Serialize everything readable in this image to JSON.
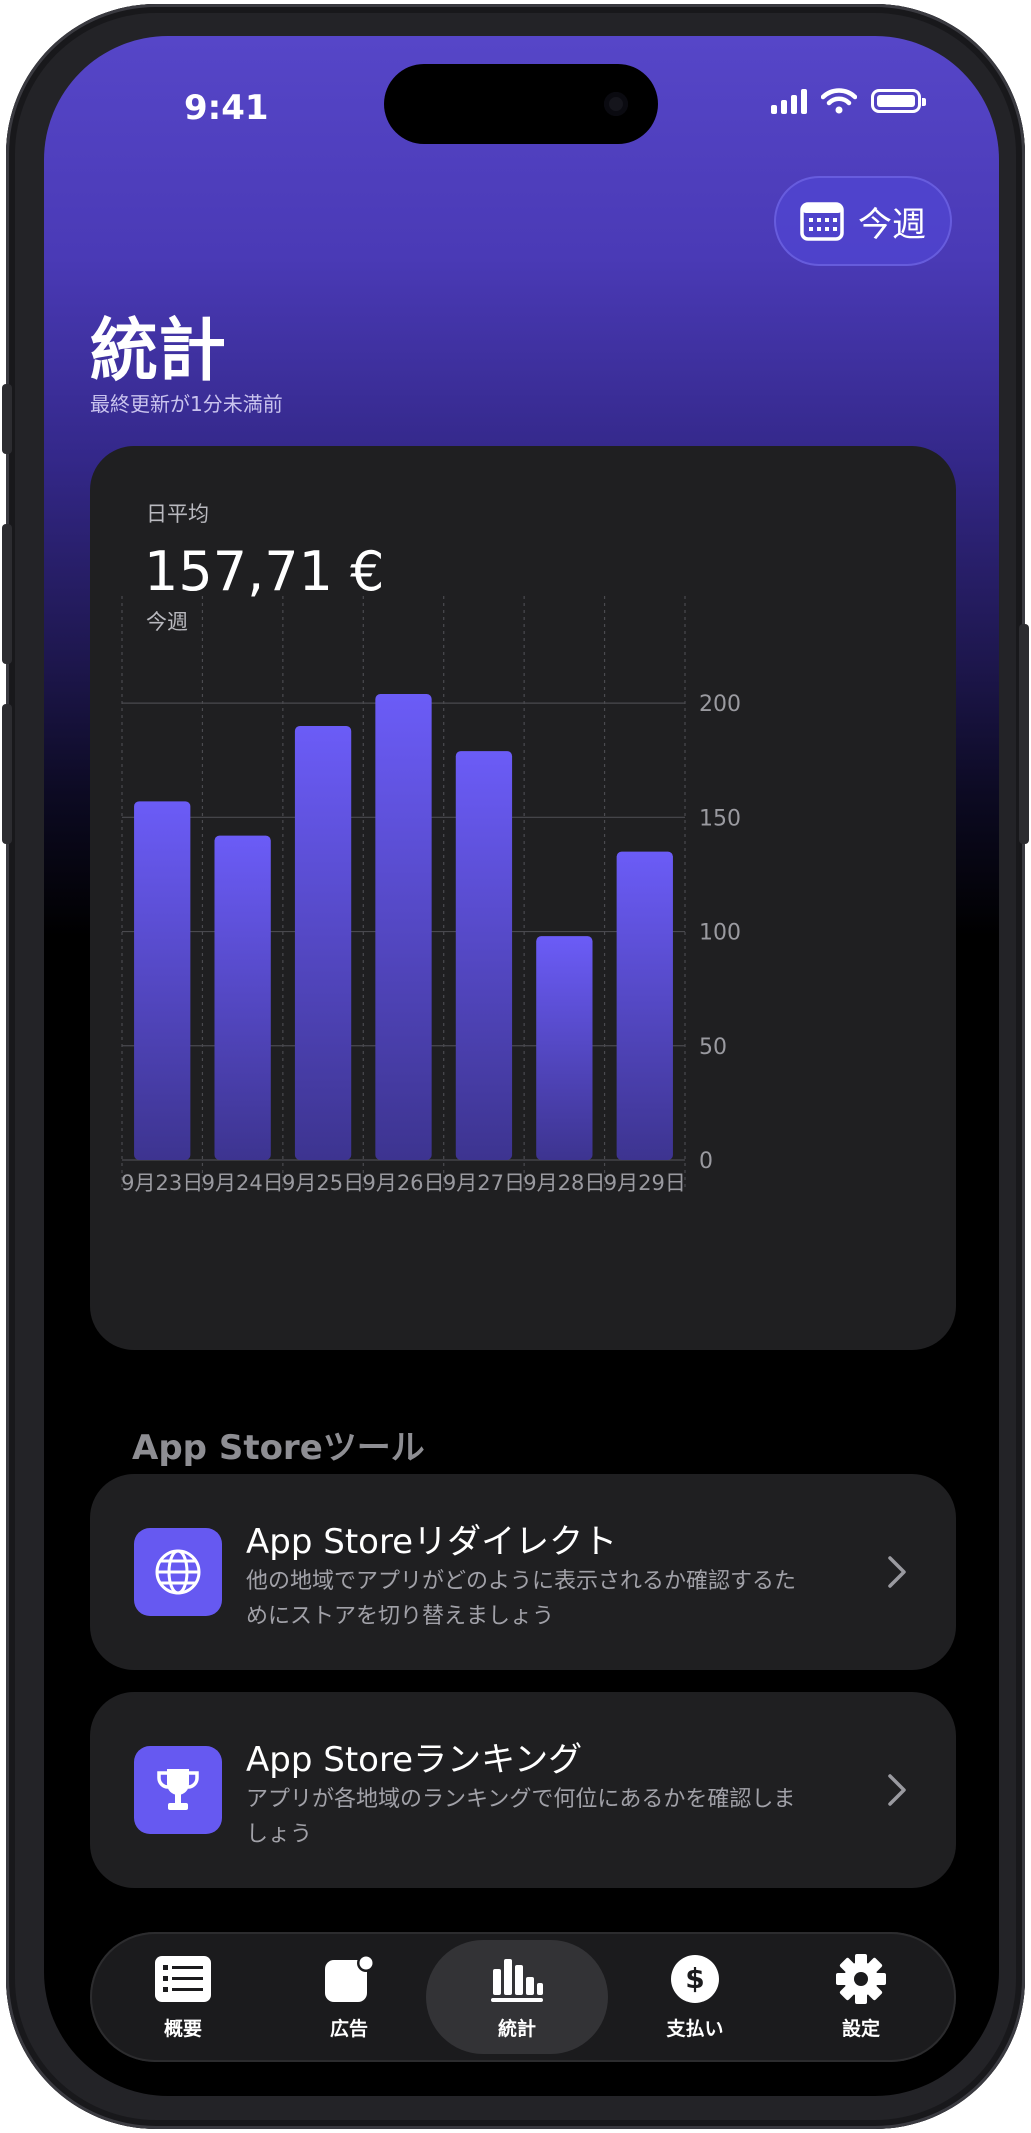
{
  "status_bar": {
    "time": "9:41"
  },
  "header": {
    "period_button": "今週",
    "title": "統計",
    "subtitle": "最終更新が1分未満前"
  },
  "stats_card": {
    "label": "日平均",
    "value": "157,71 €",
    "period": "今週"
  },
  "chart_data": {
    "type": "bar",
    "categories": [
      "9月23日",
      "9月24日",
      "9月25日",
      "9月26日",
      "9月27日",
      "9月28日",
      "9月29日"
    ],
    "values": [
      157,
      142,
      190,
      204,
      179,
      98,
      135
    ],
    "y_ticks": [
      "0",
      "50",
      "100",
      "150",
      "200"
    ],
    "ylim": [
      0,
      225
    ],
    "grid": true,
    "y_axis_position": "right",
    "bar_color_top": "#6b5cf7",
    "bar_color_bottom": "#3d3490"
  },
  "tools": {
    "section_title": "App Storeツール",
    "items": [
      {
        "title": "App Storeリダイレクト",
        "description": "他の地域でアプリがどのように表示されるか確認するためにストアを切り替えましょう",
        "icon": "globe-icon"
      },
      {
        "title": "App Storeランキング",
        "description": "アプリが各地域のランキングで何位にあるかを確認しましょう",
        "icon": "trophy-icon"
      }
    ]
  },
  "tabbar": {
    "items": [
      {
        "label": "概要",
        "icon": "list-icon"
      },
      {
        "label": "広告",
        "icon": "ads-icon"
      },
      {
        "label": "統計",
        "icon": "bar-chart-icon",
        "active": true
      },
      {
        "label": "支払い",
        "icon": "dollar-icon"
      },
      {
        "label": "設定",
        "icon": "gear-icon"
      }
    ]
  },
  "colors": {
    "accent": "#6659f1",
    "header_gradient_top": "#5646c8"
  }
}
